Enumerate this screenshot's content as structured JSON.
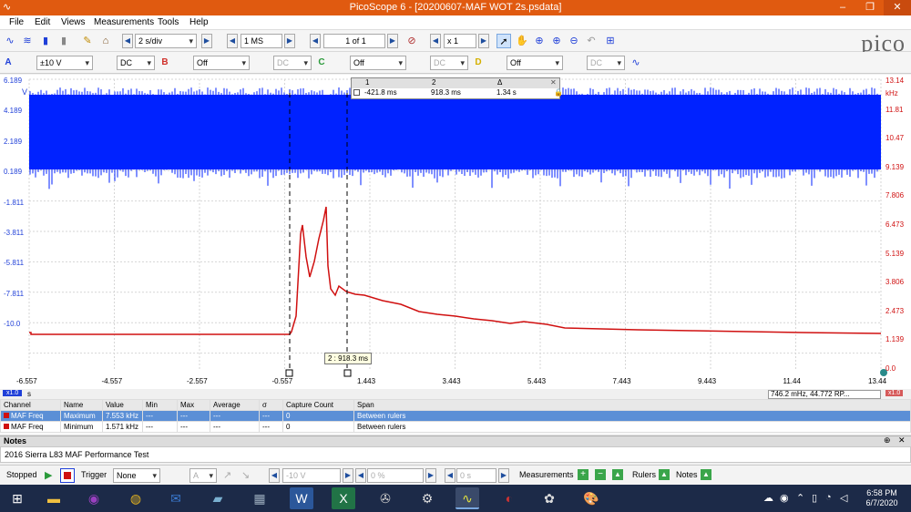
{
  "window": {
    "title": "PicoScope 6 - [20200607-MAF WOT 2s.psdata]",
    "min": "–",
    "restore": "❐",
    "close": "✕"
  },
  "menu": [
    "File",
    "Edit",
    "Views",
    "Measurements",
    "Tools",
    "Help"
  ],
  "toolbar": {
    "timebase": "2 s/div",
    "samples": "1 MS",
    "buffer": "1 of 1",
    "zoom": "x 1"
  },
  "channels": [
    {
      "label": "A",
      "range": "±10 V",
      "coupling": "DC",
      "color": "#1f3fd8"
    },
    {
      "label": "B",
      "range": "Off",
      "coupling": "DC",
      "color": "#d0302a"
    },
    {
      "label": "C",
      "range": "Off",
      "coupling": "DC",
      "color": "#2a9a3a"
    },
    {
      "label": "D",
      "range": "Off",
      "coupling": "DC",
      "color": "#d4b000"
    }
  ],
  "plot": {
    "left_axis": [
      "6.189",
      "4.189",
      "2.189",
      "0.189",
      "-1.811",
      "-3.811",
      "-5.811",
      "-7.811",
      "-10.0"
    ],
    "left_unit": "V",
    "right_axis": [
      "13.14",
      "11.81",
      "10.47",
      "9.139",
      "7.806",
      "6.473",
      "5.139",
      "3.806",
      "2.473",
      "1.139",
      "0.0"
    ],
    "right_unit": "kHz",
    "x_axis": [
      "-6.557",
      "-4.557",
      "-2.557",
      "-0.557",
      "1.443",
      "3.443",
      "5.443",
      "7.443",
      "9.443",
      "11.44",
      "13.44"
    ],
    "x_unit": "s",
    "x_scale": "x1.0",
    "ruler_table": {
      "h1": "1",
      "h2": "2",
      "h3": "Δ",
      "v1": "-421.8 ms",
      "v2": "918.3 ms",
      "v3": "1.34 s"
    },
    "ruler_label": "2 : 918.3 ms",
    "freq_readout": "746.2 mHz, 44.772 RP...",
    "right_scale": "x1.0"
  },
  "measurements": {
    "headers": [
      "Channel",
      "Name",
      "Value",
      "Min",
      "Max",
      "Average",
      "σ",
      "Capture Count",
      "Span"
    ],
    "rows": [
      [
        "MAF Freq",
        "Maximum",
        "7.553 kHz",
        "---",
        "---",
        "---",
        "---",
        "0",
        "Between rulers"
      ],
      [
        "MAF Freq",
        "Minimum",
        "1.571 kHz",
        "---",
        "---",
        "---",
        "---",
        "0",
        "Between rulers"
      ]
    ]
  },
  "notes": {
    "header": "Notes",
    "text": "2016 Sierra L83 MAF Performance Test"
  },
  "status": {
    "stopped": "Stopped",
    "trigger": "Trigger",
    "trigger_mode": "None",
    "trig_ch": "A",
    "level": "-10 V",
    "pretrig": "0 %",
    "delay": "0 s",
    "measurements": "Measurements",
    "rulers": "Rulers",
    "notes": "Notes"
  },
  "clock": {
    "time": "6:58 PM",
    "date": "6/7/2020"
  },
  "taskbar_icons": [
    "windows-start-icon",
    "file-explorer-icon",
    "media-icon",
    "chrome-icon",
    "mail-icon",
    "notes-icon",
    "calculator-icon",
    "word-icon",
    "excel-icon",
    "tool-icon",
    "piston-icon",
    "picoscope-icon",
    "app2-icon",
    "app3-icon",
    "paint-icon"
  ]
}
